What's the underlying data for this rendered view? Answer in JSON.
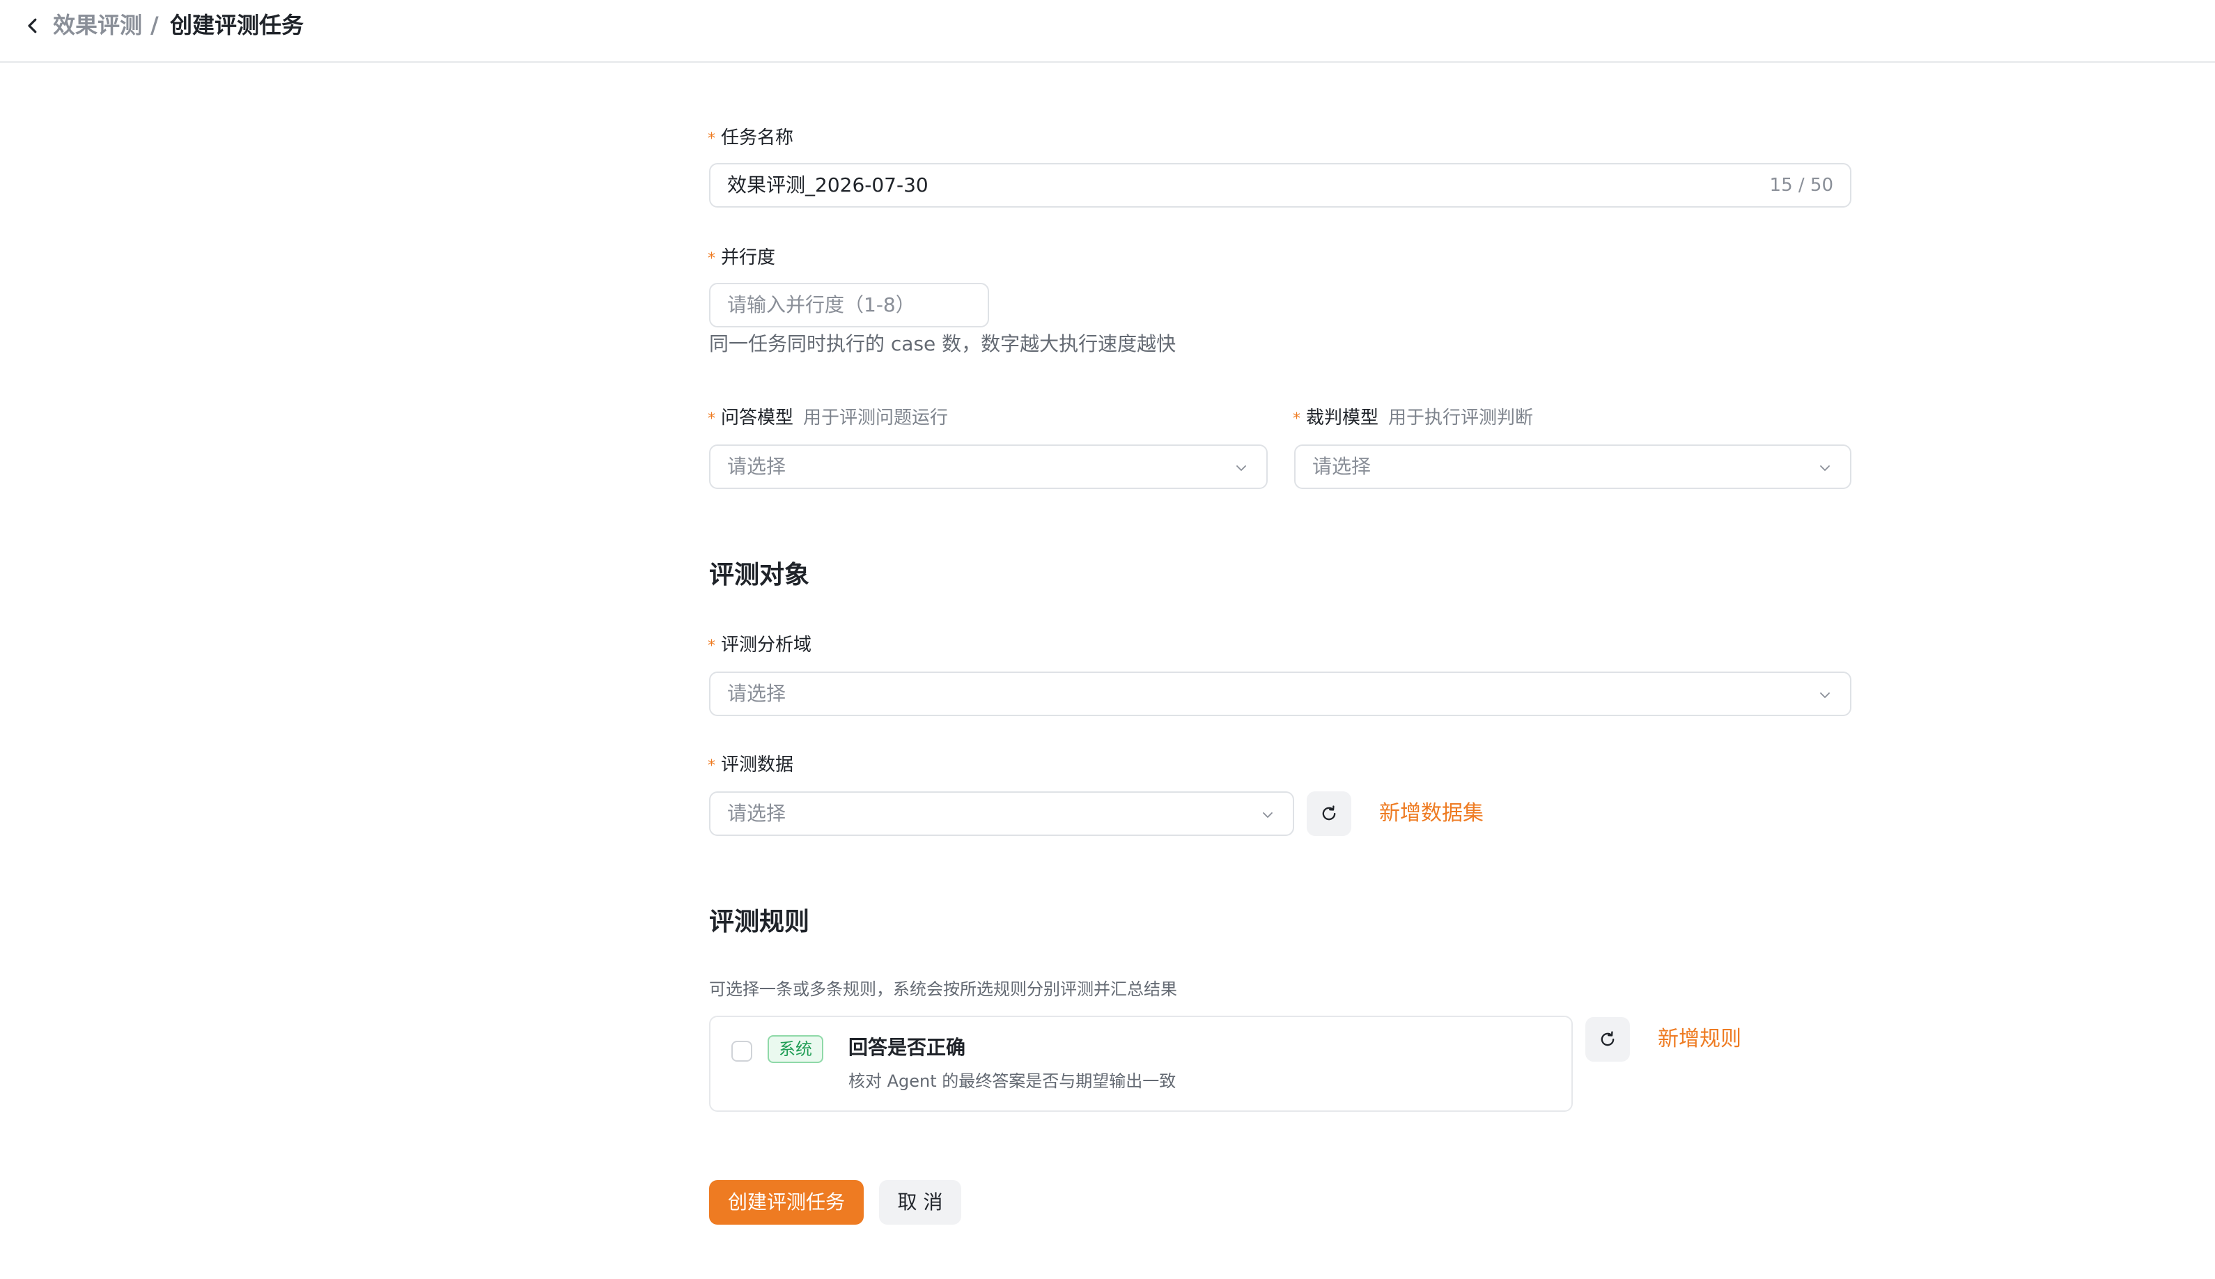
{
  "breadcrumb": {
    "parent": "效果评测",
    "separator": "/",
    "current": "创建评测任务"
  },
  "form": {
    "task_name": {
      "label": "任务名称",
      "value": "效果评测_2026-07-30",
      "counter": "15 / 50"
    },
    "concurrency": {
      "label": "并行度",
      "placeholder": "请输入并行度（1-8）",
      "hint": "同一任务同时执行的 case 数，数字越大执行速度越快"
    },
    "qa_model": {
      "label": "问答模型",
      "sublabel": "用于评测问题运行",
      "placeholder": "请选择"
    },
    "judge_model": {
      "label": "裁判模型",
      "sublabel": "用于执行评测判断",
      "placeholder": "请选择"
    }
  },
  "eval_target": {
    "title": "评测对象",
    "domain": {
      "label": "评测分析域",
      "placeholder": "请选择"
    },
    "data": {
      "label": "评测数据",
      "placeholder": "请选择",
      "add_link": "新增数据集"
    }
  },
  "eval_rules": {
    "title": "评测规则",
    "hint": "可选择一条或多条规则，系统会按所选规则分别评测并汇总结果",
    "add_link": "新增规则",
    "rules": [
      {
        "tag": "系统",
        "title": "回答是否正确",
        "desc": "核对 Agent 的最终答案是否与期望输出一致",
        "checked": false
      }
    ]
  },
  "actions": {
    "submit": "创建评测任务",
    "cancel": "取 消"
  },
  "required_mark": "*",
  "colors": {
    "accent": "#ee7b22",
    "tag_green": "#1f9d55",
    "border": "#dfe2e6"
  }
}
